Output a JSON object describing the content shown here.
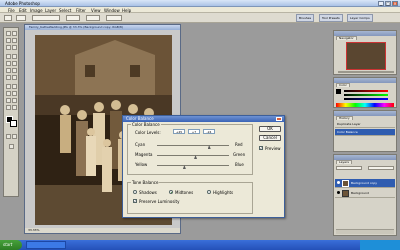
{
  "app": {
    "title": "Adobe Photoshop",
    "window_buttons": [
      "_",
      "□",
      "×"
    ]
  },
  "menu": [
    "File",
    "Edit",
    "Image",
    "Layer",
    "Select",
    "Filter",
    "View",
    "Window",
    "Help"
  ],
  "panel_well_tabs": [
    "Brushes",
    "Tool Presets",
    "Layer Comps"
  ],
  "document": {
    "title": "Family_KatheWedding.JPG @ 33.3% (Background copy, RGB/8)",
    "zoom": "33.33%"
  },
  "dialog": {
    "title": "Color Balance",
    "color_balance_group": "Color Balance",
    "color_levels_label": "Color Levels:",
    "levels": [
      "+45",
      "+7",
      "-24"
    ],
    "sliders": [
      {
        "left": "Cyan",
        "right": "Red",
        "value": 45
      },
      {
        "left": "Magenta",
        "right": "Green",
        "value": 7
      },
      {
        "left": "Yellow",
        "right": "Blue",
        "value": -24
      }
    ],
    "tone_group": "Tone Balance",
    "tones": [
      "Shadows",
      "Midtones",
      "Highlights"
    ],
    "tone_selected": "Midtones",
    "preserve_luminosity": "Preserve Luminosity",
    "preserve_checked": true,
    "ok": "OK",
    "cancel": "Cancel",
    "preview": "Preview",
    "preview_checked": true
  },
  "palettes": {
    "navigator": "Navigator",
    "color": "Color",
    "history": "History",
    "history_items": [
      "Duplicate Layer",
      "Color Balance"
    ],
    "layers": "Layers",
    "layer_items": [
      "Background copy",
      "Background"
    ]
  },
  "taskbar": {
    "start": "start"
  }
}
